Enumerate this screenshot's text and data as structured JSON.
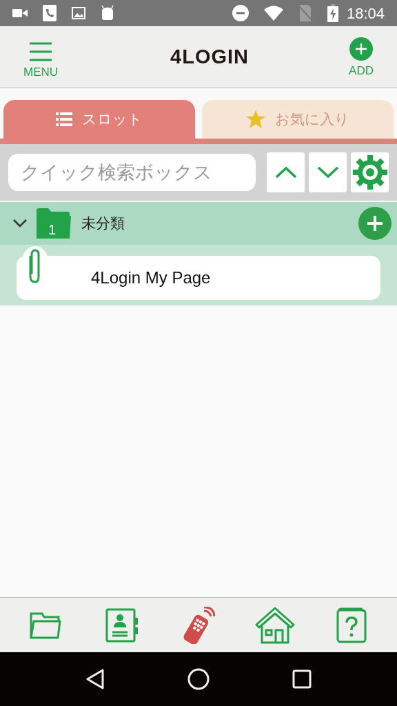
{
  "status_bar": {
    "time": "18:04"
  },
  "header": {
    "menu_label": "MENU",
    "logo": "4LOGIN",
    "add_label": "ADD"
  },
  "tabs": [
    {
      "label": "スロット",
      "kind": "list",
      "selected": true
    },
    {
      "label": "お気に入り",
      "kind": "star",
      "selected": false
    }
  ],
  "search": {
    "placeholder": "クイック検索ボックス"
  },
  "tree": [
    {
      "name": "未分類",
      "count": "1",
      "expanded": true,
      "children": [
        {
          "name": "4Login My Page"
        }
      ]
    }
  ],
  "bottom_nav": [
    {
      "kind": "folder",
      "selected": false
    },
    {
      "kind": "contacts",
      "selected": false
    },
    {
      "kind": "remote",
      "selected": true
    },
    {
      "kind": "home",
      "selected": false
    },
    {
      "kind": "help",
      "selected": false
    }
  ]
}
